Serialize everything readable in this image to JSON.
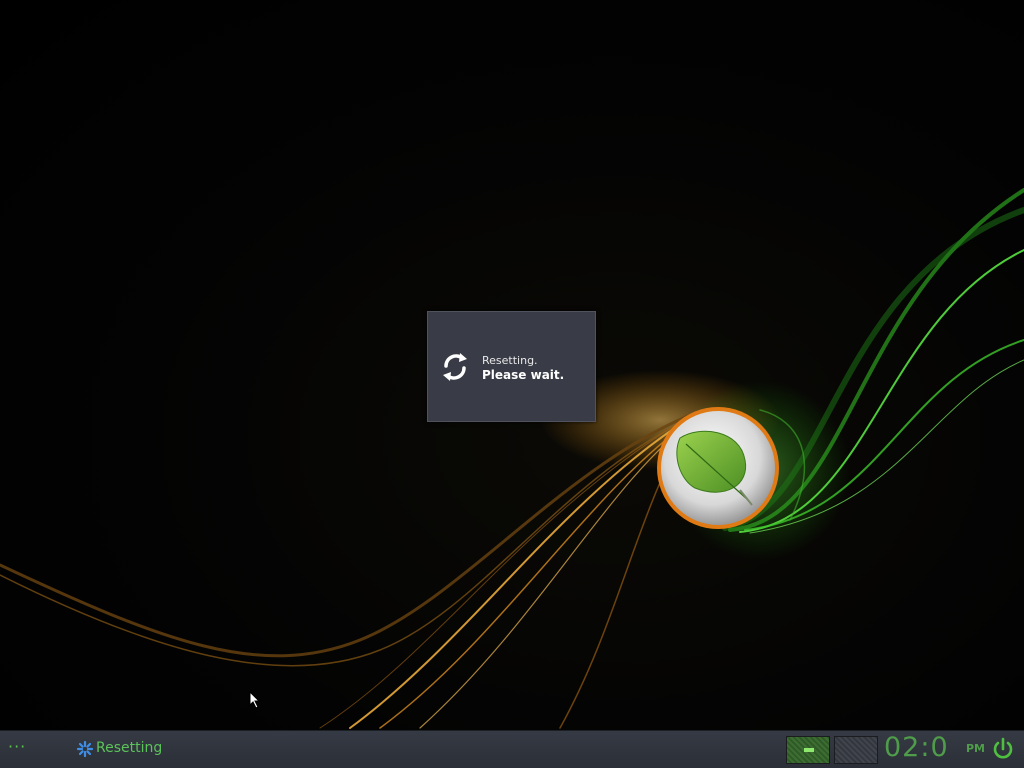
{
  "dialog": {
    "line1": "Resetting.",
    "line2": "Please wait.",
    "icon": "refresh-icon"
  },
  "taskbar": {
    "menu_label": "···",
    "task_label": "Resetting",
    "task_icon": "gear-spinner-icon",
    "workspaces": [
      "workspace-1",
      "workspace-2"
    ],
    "clock_text": "02:0",
    "ampm": "PM",
    "power_icon": "power-icon"
  },
  "colors": {
    "accent_green": "#5cc25a",
    "dialog_bg": "#393c46",
    "taskbar_bg": "#2f333b",
    "wave_orange": "#e89a2a",
    "wave_green": "#4ee03a"
  }
}
